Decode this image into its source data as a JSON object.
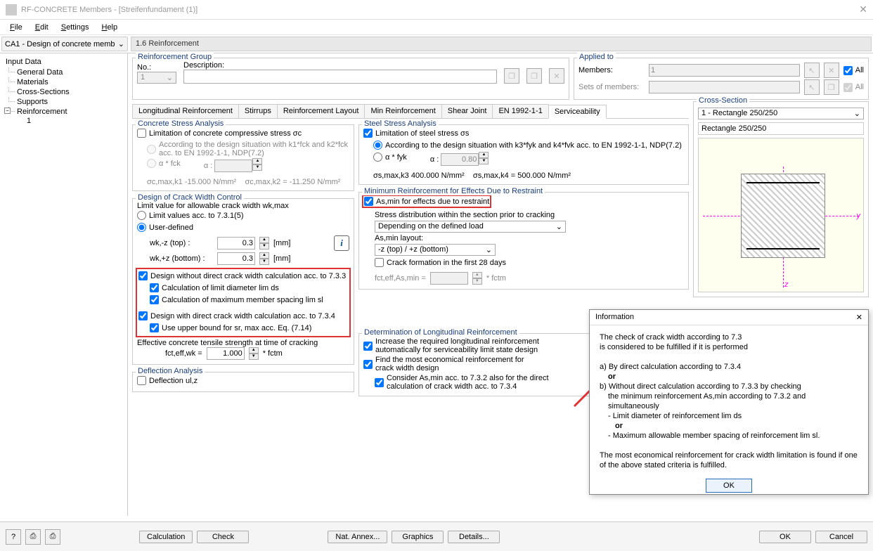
{
  "window": {
    "title": "RF-CONCRETE Members - [Streifenfundament (1)]"
  },
  "menu": {
    "file": "File",
    "edit": "Edit",
    "settings": "Settings",
    "help": "Help"
  },
  "case_dropdown": "CA1 - Design of concrete memb",
  "page_header": "1.6 Reinforcement",
  "tree": {
    "root": "Input Data",
    "items": [
      "General Data",
      "Materials",
      "Cross-Sections",
      "Supports",
      "Reinforcement"
    ],
    "reinf_child": "1"
  },
  "reinf_group": {
    "legend": "Reinforcement Group",
    "no_label": "No.:",
    "no_value": "1",
    "desc_label": "Description:",
    "desc_value": ""
  },
  "applied_to": {
    "legend": "Applied to",
    "members_label": "Members:",
    "members_value": "1",
    "sets_label": "Sets of members:",
    "sets_value": "",
    "all_label": "All"
  },
  "tabs": [
    "Longitudinal Reinforcement",
    "Stirrups",
    "Reinforcement Layout",
    "Min Reinforcement",
    "Shear Joint",
    "EN 1992-1-1",
    "Serviceability"
  ],
  "active_tab": 6,
  "concrete_stress": {
    "legend": "Concrete Stress Analysis",
    "limitation": "Limitation of concrete compressive stress σc",
    "r1": "According to the design situation with k1*fck and    k2*fck acc. to EN 1992-1-1, NDP(7.2)",
    "r2": "α * fck",
    "alpha_label": "α :",
    "alpha_value": "",
    "note_left": "σc,max,k1   -15.000 N/mm²",
    "note_right": "σc,max,k2 = -11.250 N/mm²"
  },
  "steel_stress": {
    "legend": "Steel Stress Analysis",
    "limitation": "Limitation of steel stress σs",
    "r1": "According to the design situation with k3*fyk and k4*fvk acc. to EN 1992-1-1, NDP(7.2)",
    "r2": "α * fyk",
    "alpha_label": "α :",
    "alpha_value": "0.80",
    "note_left": "σs,max,k3    400.000 N/mm²",
    "note_right": "σs,max,k4 = 500.000 N/mm²"
  },
  "crack": {
    "legend": "Design of Crack Width Control",
    "limit_label": "Limit value for allowable crack width wk,max",
    "r1": "Limit values acc. to 7.3.1(5)",
    "r2": "User-defined",
    "wk_top_label": "wk,-z (top) :",
    "wk_top_value": "0.3",
    "wk_bot_label": "wk,+z (bottom) :",
    "wk_bot_value": "0.3",
    "unit": "[mm]",
    "c1": "Design without direct crack width calculation acc. to 7.3.3",
    "c1a": "Calculation of limit diameter lim ds",
    "c1b": "Calculation of maximum member spacing lim sl",
    "c2": "Design with direct crack width calculation acc. to 7.3.4",
    "c2a": "Use upper bound for sr, max acc. Eq. (7.14)",
    "eff_label": "Effective concrete tensile strength at time of cracking",
    "fct_label": "fct,eff,wk =",
    "fct_value": "1.000",
    "fct_suffix": "* fctm"
  },
  "min_reinf": {
    "legend": "Minimum Reinforcement for Effects Due to Restraint",
    "c1": "As,min for effects due to restraint",
    "stress_dist_label": "Stress distribution within the section prior to cracking",
    "stress_dist_value": "Depending on the defined load",
    "layout_label": "As,min layout:",
    "layout_value": "-z (top) / +z (bottom)",
    "c28": "Crack formation in the first 28 days",
    "fct_label": "fct,eff,As,min =",
    "fct_value": "",
    "fct_suffix": "* fctm"
  },
  "deflection": {
    "legend": "Deflection Analysis",
    "c1": "Deflection ul,z"
  },
  "determination": {
    "legend": "Determination of Longitudinal Reinforcement",
    "c1": "Increase the required longitudinal reinforcement automatically for serviceability limit state design",
    "c2": "Find the most economical reinforcement for crack width design",
    "c3": "Consider As,min acc. to 7.3.2 also for the direct calculation of crack width acc. to 7.3.4"
  },
  "cross_section": {
    "legend": "Cross-Section",
    "combo": "1 - Rectangle 250/250",
    "name": "Rectangle 250/250"
  },
  "popup": {
    "title": "Information",
    "l1": "The check of crack width according to 7.3",
    "l2": "is considered to be fulfilled if it is performed",
    "l3": "a) By direct calculation according to 7.3.4",
    "or": "or",
    "l4": "b) Without direct calculation according to 7.3.3 by checking",
    "l5": "the minimum reinforcement As,min according to 7.3.2 and simultaneously",
    "l6": "- Limit diameter of reinforcement lim ds",
    "l7": "- Maximum allowable member spacing of reinforcement lim sl.",
    "l8": "The most economical reinforcement for crack width limitation is found if one of the above stated criteria is fulfilled.",
    "ok": "OK"
  },
  "footer": {
    "calculation": "Calculation",
    "check": "Check",
    "nat_annex": "Nat. Annex...",
    "graphics": "Graphics",
    "details": "Details...",
    "ok": "OK",
    "cancel": "Cancel"
  }
}
